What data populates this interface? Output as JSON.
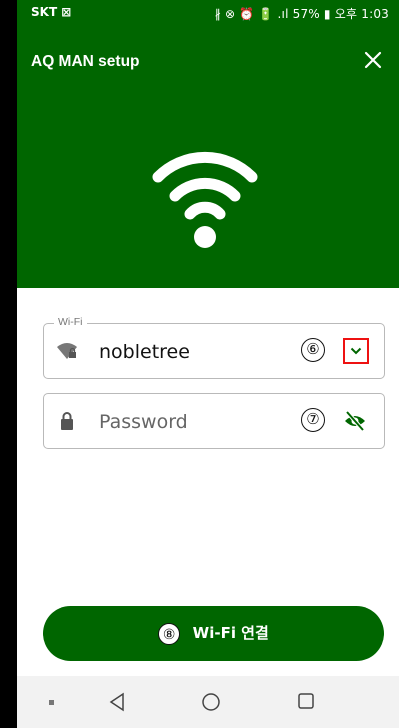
{
  "status_bar": {
    "carrier": "SKT ⊠",
    "right_text": "∦ ⊗ ⏰ 🔋 .ıl 57% ▮ 오후 1:03"
  },
  "header": {
    "title": "AQ MAN setup",
    "close_icon": "close-icon",
    "hero_icon": "wifi-icon",
    "color": "#006600"
  },
  "form": {
    "wifi": {
      "legend": "Wi-Fi",
      "value": "nobletree",
      "marker": "⑥",
      "icon": "wifi-lock-icon",
      "dropdown_icon": "chevron-down-icon"
    },
    "password": {
      "placeholder": "Password",
      "marker": "⑦",
      "icon": "lock-icon",
      "visibility_icon": "eye-off-icon"
    }
  },
  "connect_button": {
    "marker": "⑧",
    "label": "Wi-Fi 연결"
  },
  "nav_bar": {
    "icons": [
      "square-dot-icon",
      "back-icon",
      "home-icon",
      "recent-apps-icon"
    ]
  },
  "colors": {
    "brand_green": "#006600",
    "highlight_red": "#e11111"
  }
}
